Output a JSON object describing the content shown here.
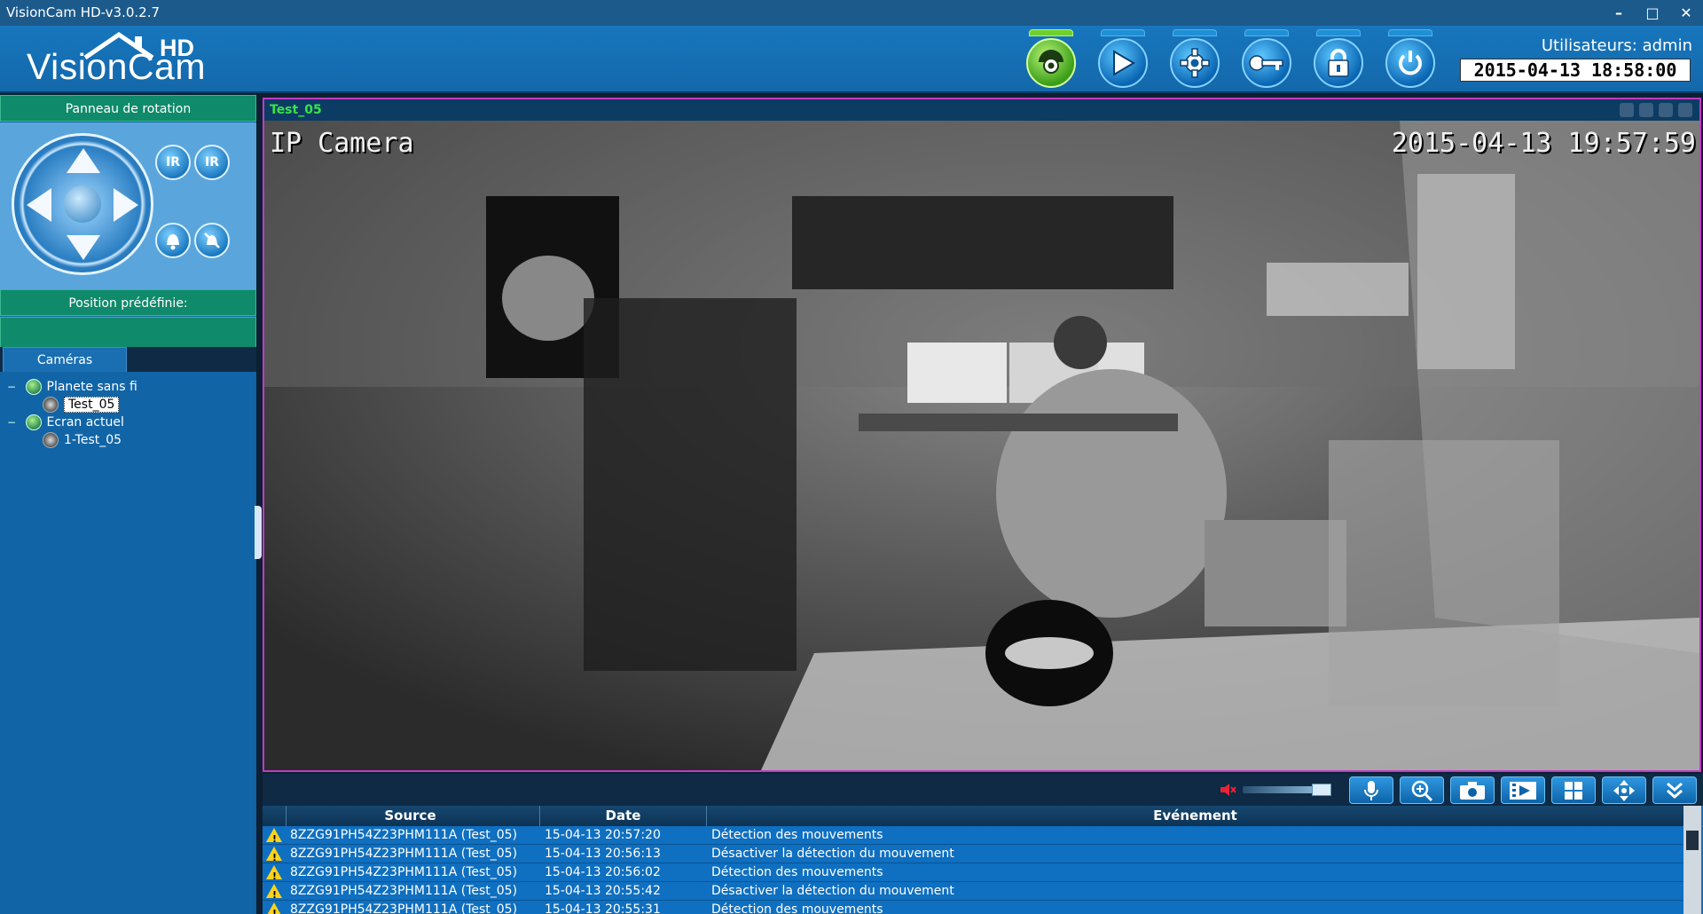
{
  "window": {
    "title": "VisionCam HD-v3.0.2.7",
    "minimize": "–",
    "maximize": "□",
    "close": "✕"
  },
  "header": {
    "logo_brand": "VisionCam",
    "logo_hd": "HD",
    "user_label": "Utilisateurs: admin",
    "clock": "2015-04-13  18:58:00",
    "toolbar": [
      {
        "name": "live-view",
        "icon": "camera-dome-icon"
      },
      {
        "name": "playback",
        "icon": "play-icon"
      },
      {
        "name": "settings",
        "icon": "gear-icon"
      },
      {
        "name": "keys",
        "icon": "key-icon"
      },
      {
        "name": "lock",
        "icon": "lock-icon"
      },
      {
        "name": "power",
        "icon": "power-icon"
      }
    ]
  },
  "left": {
    "rotation_panel": "Panneau de rotation",
    "ir_left": "IR",
    "ir_right": "IR",
    "preset_label": "Position prédéfinie:",
    "cameras_tab": "Caméras",
    "tree": [
      {
        "label": "Planete sans fi",
        "type": "group",
        "expander": "−"
      },
      {
        "label": "Test_05",
        "type": "camera",
        "selected": true
      },
      {
        "label": "Ecran actuel",
        "type": "group",
        "expander": "−"
      },
      {
        "label": "1-Test_05",
        "type": "camera",
        "selected": false
      }
    ]
  },
  "video": {
    "tab_title": "Test_05",
    "osd_name": "IP Camera",
    "osd_time": "2015-04-13  19:57:59"
  },
  "controls": [
    "microphone-icon",
    "zoom-in-icon",
    "snapshot-icon",
    "record-video-icon",
    "grid-layout-icon",
    "ptz-move-icon",
    "collapse-icon"
  ],
  "events": {
    "columns": [
      "Source",
      "Date",
      "Evénement"
    ],
    "rows": [
      {
        "source": "8ZZG91PH54Z23PHM111A (Test_05)",
        "date": "15-04-13 20:57:20",
        "event": "Détection des mouvements"
      },
      {
        "source": "8ZZG91PH54Z23PHM111A (Test_05)",
        "date": "15-04-13 20:56:13",
        "event": "Désactiver la détection du mouvement"
      },
      {
        "source": "8ZZG91PH54Z23PHM111A (Test_05)",
        "date": "15-04-13 20:56:02",
        "event": "Détection des mouvements"
      },
      {
        "source": "8ZZG91PH54Z23PHM111A (Test_05)",
        "date": "15-04-13 20:55:42",
        "event": "Désactiver la détection du mouvement"
      },
      {
        "source": "8ZZG91PH54Z23PHM111A (Test_05)",
        "date": "15-04-13 20:55:31",
        "event": "Détection des mouvements"
      }
    ]
  },
  "colors": {
    "accent": "#1468aa",
    "green_header": "#0f8a6a",
    "video_border": "#c03cc4",
    "tab_text": "#39e34a"
  }
}
